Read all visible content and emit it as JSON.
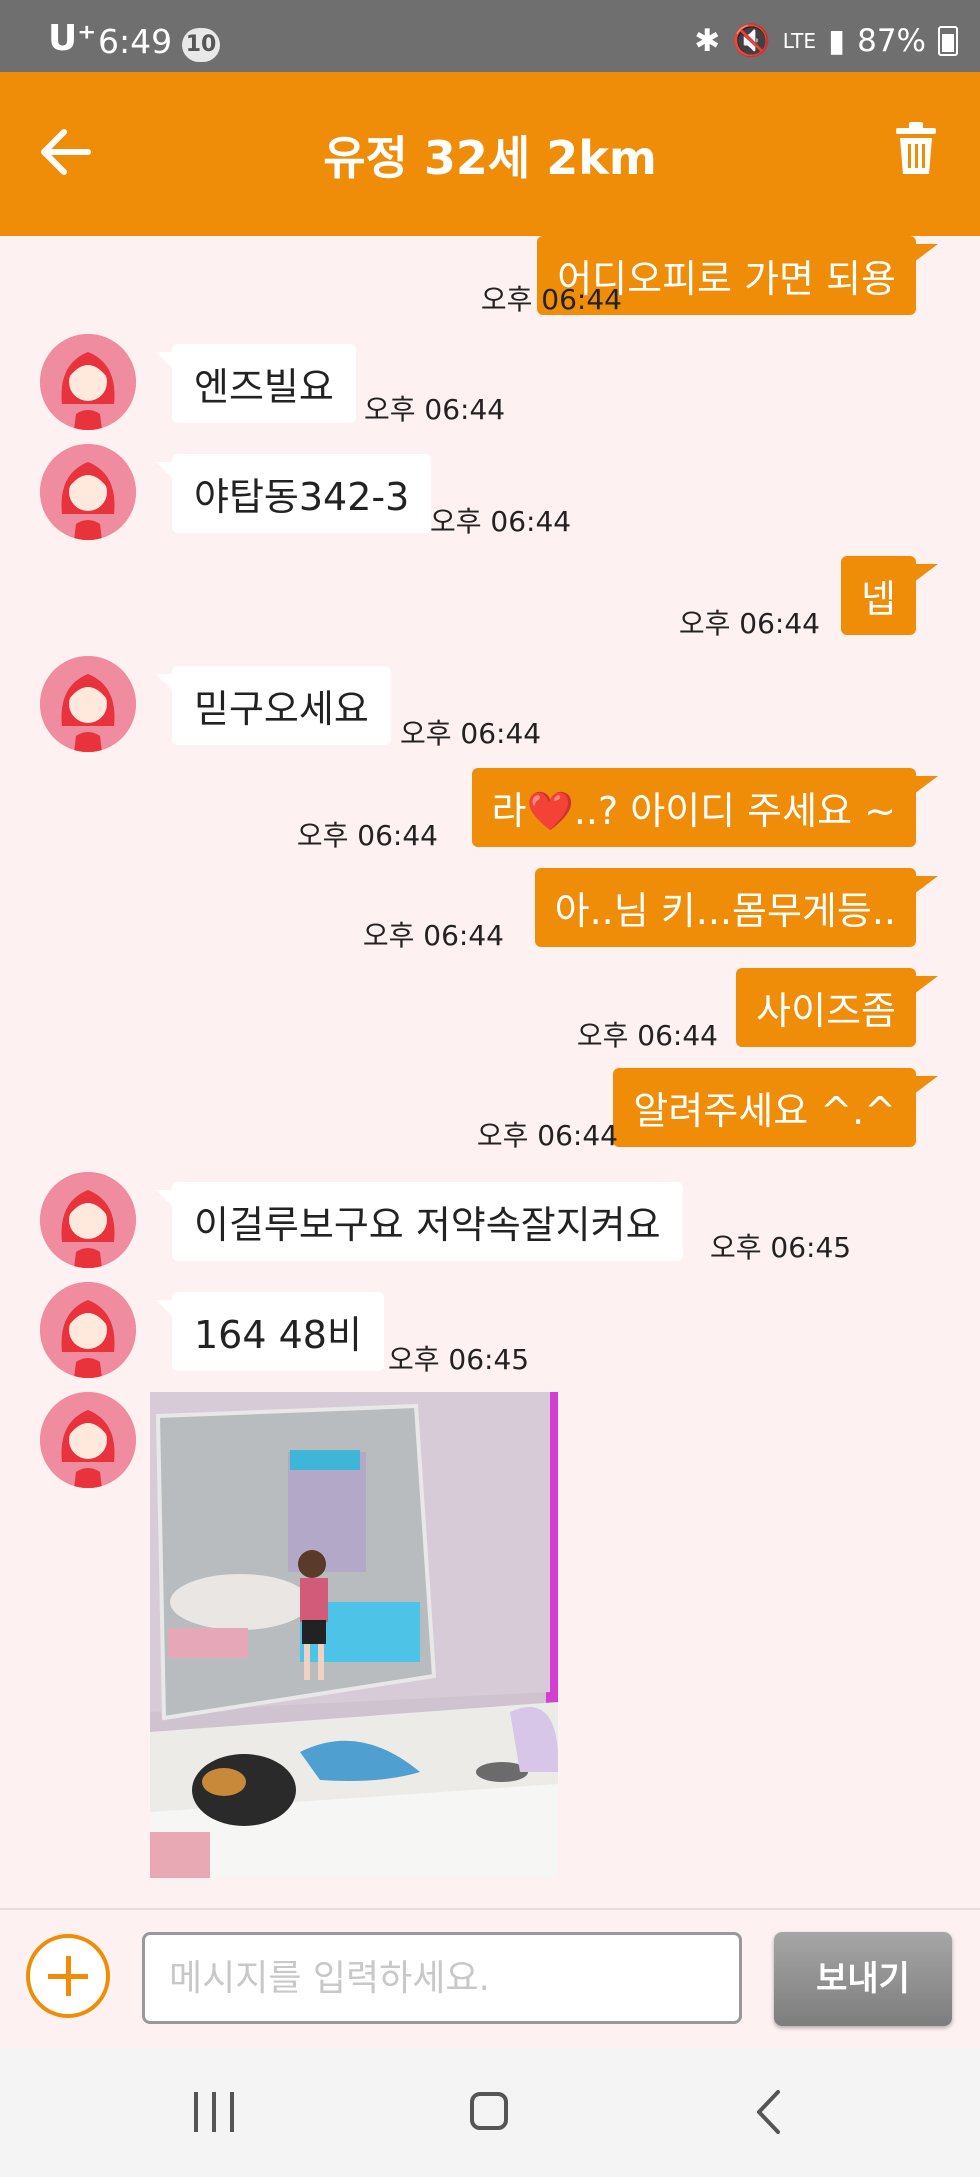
{
  "status_bar": {
    "carrier": "U⁺",
    "time": "6:49",
    "notification_count": "10",
    "network": "LTE",
    "battery": "87%"
  },
  "header": {
    "title": "유정 32세 2km"
  },
  "messages": [
    {
      "side": "out",
      "text": "어디오피로 가면 되용",
      "time": "오후 06:44"
    },
    {
      "side": "in",
      "text": "엔즈빌요",
      "time": "오후 06:44"
    },
    {
      "side": "in",
      "text": "야탑동342-3",
      "time": "오후 06:44"
    },
    {
      "side": "out",
      "text": "넵",
      "time": "오후 06:44"
    },
    {
      "side": "in",
      "text": "믿구오세요",
      "time": "오후 06:44"
    },
    {
      "side": "out",
      "text": "라❤️..? 아이디 주세요 ~",
      "time": "오후 06:44"
    },
    {
      "side": "out",
      "text": "아..님 키...몸무게등..",
      "time": "오후 06:44"
    },
    {
      "side": "out",
      "text": "사이즈좀",
      "time": "오후 06:44"
    },
    {
      "side": "out",
      "text": "알려주세요 ^.^",
      "time": "오후 06:44"
    },
    {
      "side": "in",
      "text": "이걸루보구요  저약속잘지켜요",
      "time": "오후 06:45"
    },
    {
      "side": "in",
      "text": "164  48비",
      "time": "오후 06:45"
    },
    {
      "side": "in",
      "type": "image",
      "text": "photo"
    }
  ],
  "composer": {
    "placeholder": "메시지를 입력하세요.",
    "send_label": "보내기"
  },
  "colors": {
    "accent": "#ef8c08",
    "background": "#fdf1f1",
    "status_bar": "#6f6f6f"
  }
}
